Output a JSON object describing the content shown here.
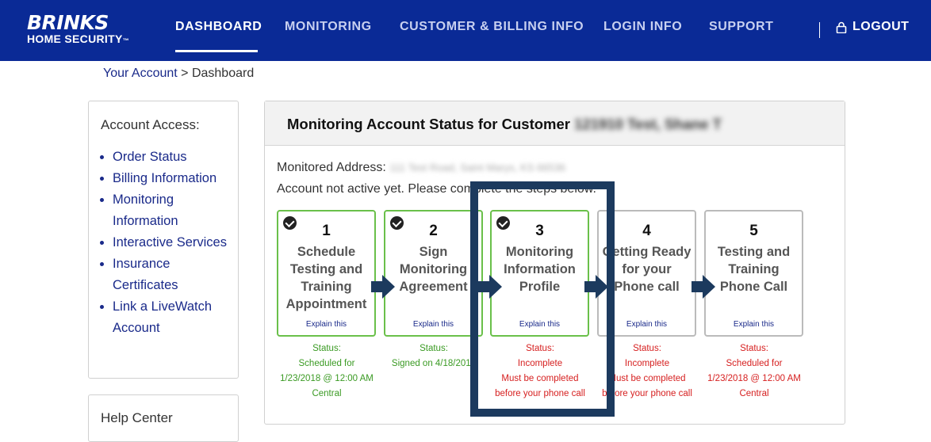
{
  "brand": {
    "name": "BRINKS",
    "sub": "HOME SECURITY",
    "tm": "™"
  },
  "nav": {
    "items": [
      "DASHBOARD",
      "MONITORING",
      "CUSTOMER & BILLING INFO",
      "LOGIN INFO",
      "SUPPORT"
    ],
    "active": "DASHBOARD",
    "logout": "LOGOUT"
  },
  "breadcrumb": {
    "link": "Your Account",
    "separator": " > ",
    "current": "Dashboard"
  },
  "sidebar": {
    "title": "Account Access:",
    "items": [
      "Order Status",
      "Billing Information",
      "Monitoring Information",
      "Interactive Services",
      "Insurance Certificates",
      "Link a LiveWatch Account"
    ]
  },
  "help": {
    "title": "Help Center"
  },
  "main": {
    "title": "Monitoring Account Status for Customer",
    "customer_redacted": "121910 Test, Shane T",
    "address_label": "Monitored Address:",
    "address_redacted": "111 Test Road, Saint Marys, KS 66536",
    "notice": "Account not active yet. Please complete the steps below.",
    "explain_label": "Explain this",
    "steps": [
      {
        "num": "1",
        "title": "Schedule Testing and Training Appointment",
        "done": true,
        "status": [
          "Status:",
          "Scheduled for",
          "1/23/2018 @ 12:00 AM",
          "Central"
        ]
      },
      {
        "num": "2",
        "title": "Sign Monitoring Agreement",
        "done": true,
        "status": [
          "Status:",
          "Signed on 4/18/2018"
        ]
      },
      {
        "num": "3",
        "title": "Monitoring Information Profile",
        "done": true,
        "status": [
          "Status:",
          "Incomplete",
          "Must be completed",
          "before your phone call"
        ]
      },
      {
        "num": "4",
        "title": "Getting Ready for your Phone call",
        "done": false,
        "status": [
          "Status:",
          "Incomplete",
          "Must be completed",
          "before your phone call"
        ]
      },
      {
        "num": "5",
        "title": "Testing and Training Phone Call",
        "done": false,
        "status": [
          "Status:",
          "Scheduled for",
          "1/23/2018 @ 12:00 AM",
          "Central"
        ]
      }
    ]
  },
  "colors": {
    "header_bg": "#0a2a96",
    "link": "#1a2a8a",
    "done_border": "#6ac04a",
    "status_green": "#3a9a23",
    "status_red": "#d62020",
    "arrow": "#1c3a5e",
    "highlight": "#1c3a5e"
  }
}
